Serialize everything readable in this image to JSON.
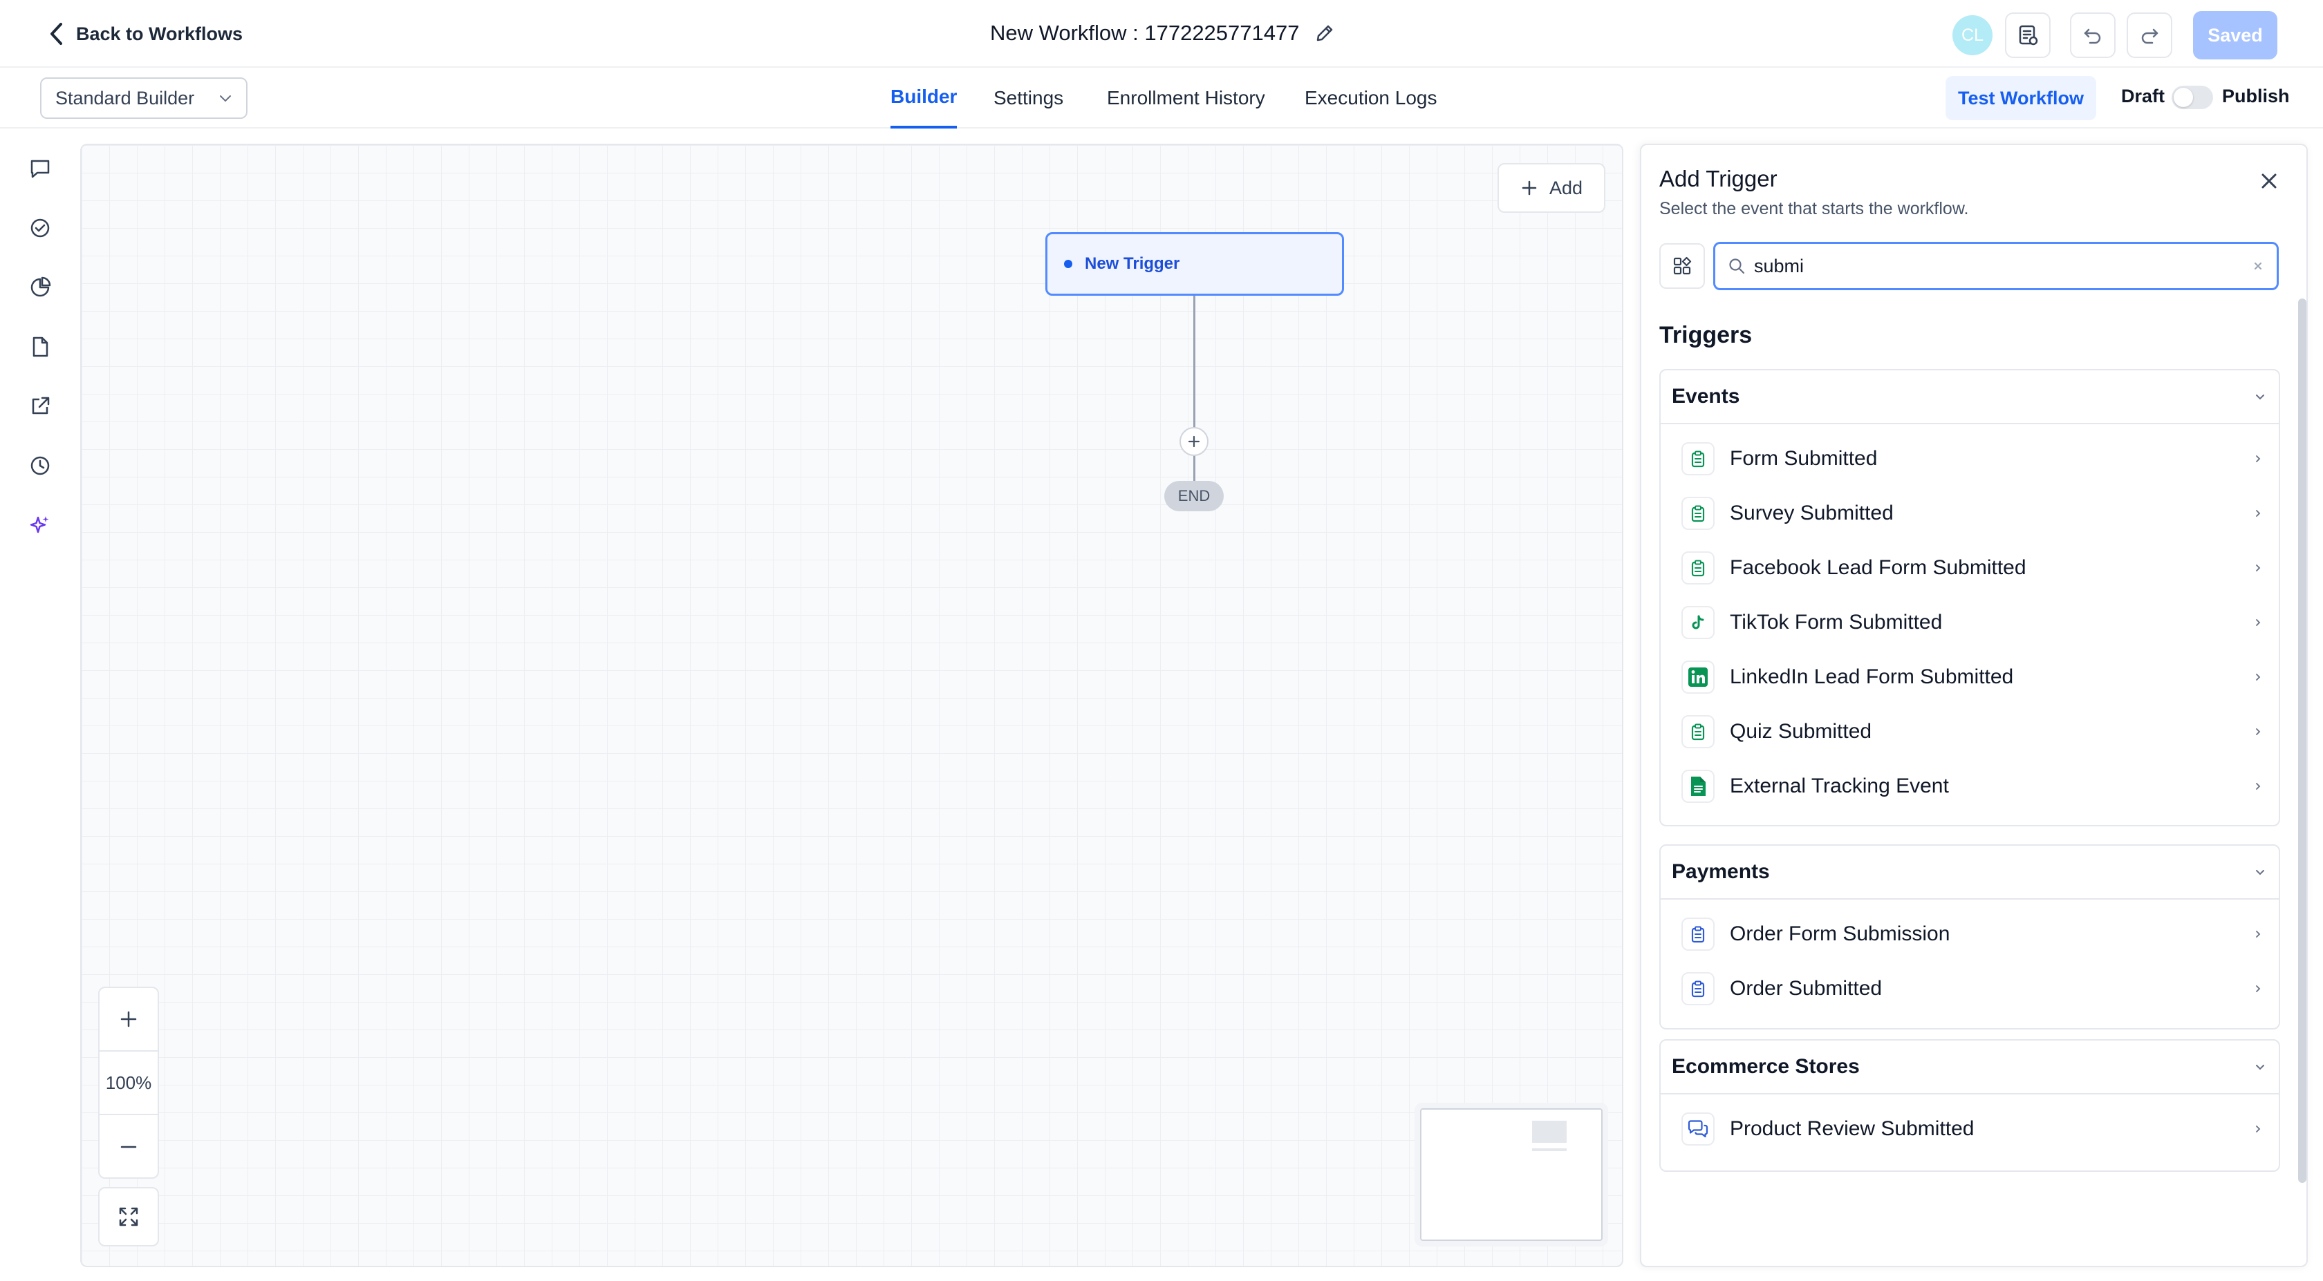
{
  "header": {
    "back_label": "Back to Workflows",
    "title": "New Workflow : 1772225771477",
    "avatar_initials": "CL",
    "saved_label": "Saved"
  },
  "subbar": {
    "builder_mode": "Standard Builder",
    "tabs": [
      {
        "label": "Builder",
        "active": true
      },
      {
        "label": "Settings",
        "active": false
      },
      {
        "label": "Enrollment History",
        "active": false
      },
      {
        "label": "Execution Logs",
        "active": false
      }
    ],
    "test_workflow_label": "Test Workflow",
    "draft_label": "Draft",
    "publish_label": "Publish",
    "published": false
  },
  "canvas": {
    "add_label": "Add",
    "trigger_node_label": "New Trigger",
    "end_label": "END",
    "zoom_level": "100%"
  },
  "panel": {
    "title": "Add Trigger",
    "subtitle": "Select the event that starts the workflow.",
    "search_value": "submi",
    "section_heading": "Triggers",
    "groups": [
      {
        "name": "Events",
        "items": [
          {
            "label": "Form Submitted",
            "icon": "clipboard-icon"
          },
          {
            "label": "Survey Submitted",
            "icon": "clipboard-icon"
          },
          {
            "label": "Facebook Lead Form Submitted",
            "icon": "clipboard-icon"
          },
          {
            "label": "TikTok Form Submitted",
            "icon": "tiktok-icon"
          },
          {
            "label": "LinkedIn Lead Form Submitted",
            "icon": "linkedin-icon"
          },
          {
            "label": "Quiz Submitted",
            "icon": "clipboard-icon"
          },
          {
            "label": "External Tracking Event",
            "icon": "document-icon"
          }
        ]
      },
      {
        "name": "Payments",
        "items": [
          {
            "label": "Order Form Submission",
            "icon": "clipboard-icon"
          },
          {
            "label": "Order Submitted",
            "icon": "clipboard-icon"
          }
        ]
      },
      {
        "name": "Ecommerce Stores",
        "items": [
          {
            "label": "Product Review Submitted",
            "icon": "chat-bubbles-icon"
          }
        ]
      }
    ]
  },
  "colors": {
    "accent": "#155eef",
    "trigger_green": "#079455",
    "payments_blue": "#2e5bd6",
    "saved_disabled": "#a7c3ff",
    "ai_purple": "#6938ef"
  }
}
